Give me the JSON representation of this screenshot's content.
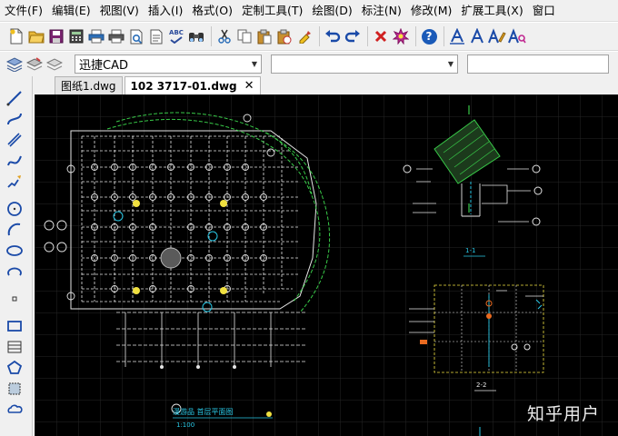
{
  "menu": {
    "items": [
      "文件(F)",
      "编辑(E)",
      "视图(V)",
      "插入(I)",
      "格式(O)",
      "定制工具(T)",
      "绘图(D)",
      "标注(N)",
      "修改(M)",
      "扩展工具(X)",
      "窗口"
    ]
  },
  "toolbar": {
    "icons": [
      "new-file-icon",
      "open-file-icon",
      "save-icon",
      "calculator-icon",
      "print-icon",
      "print-preview-icon",
      "publish-icon",
      "spellcheck-icon",
      "find-icon",
      "cut-icon",
      "copy-icon",
      "paste-icon",
      "paste-special-icon",
      "match-properties-icon",
      "undo-icon",
      "redo-icon",
      "erase-icon",
      "explode-icon",
      "help-icon",
      "text-style-icon",
      "text-icon",
      "text-edit-icon",
      "text-find-icon"
    ],
    "spellcheck_glyph": "ABC",
    "help_glyph": "?"
  },
  "layers_toolbar": {
    "layer_select_value": "迅捷CAD",
    "linetype_select_value": "",
    "lineweight_select_value": ""
  },
  "tabs": [
    {
      "label": "图纸1.dwg",
      "active": false
    },
    {
      "label": "102 3717-01.dwg",
      "active": true,
      "close": "✕"
    }
  ],
  "drawing": {
    "background_color": "#000000",
    "main_title_line1": "漫游品 首层平面图",
    "main_title_line2": "1:100",
    "section_label_a": "1-1",
    "section_label_b": "2-2",
    "watermark": "知乎用户"
  },
  "colors": {
    "menu_bg": "#f0f0f0",
    "canvas_bg": "#000000",
    "drawing_white": "#e6e6e6",
    "drawing_green": "#38c948",
    "drawing_cyan": "#29c8e6",
    "drawing_yellow": "#f0e040",
    "drawing_orange": "#e86a20"
  }
}
